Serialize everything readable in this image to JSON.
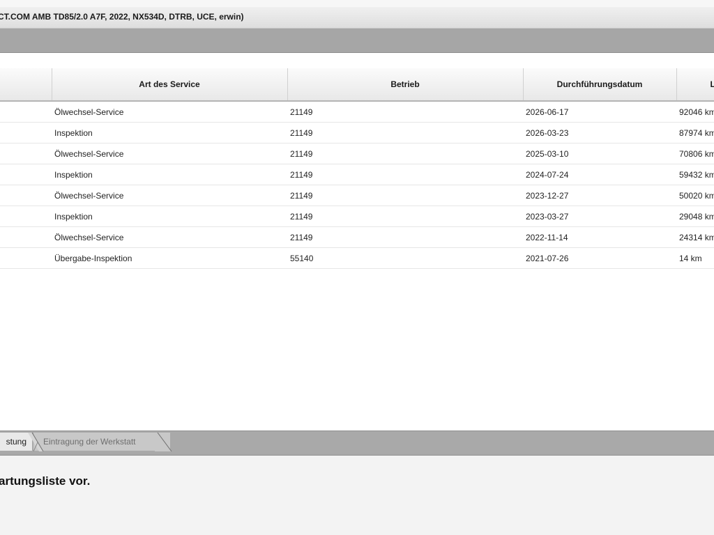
{
  "window": {
    "title": "CT.COM AMB TD85/2.0 A7F, 2022, NX534D, DTRB, UCE, erwin)"
  },
  "table": {
    "headers": [
      "",
      "Art des Service",
      "Betrieb",
      "Durchführungsdatum",
      "L"
    ],
    "rows": [
      {
        "service": "Ölwechsel-Service",
        "betrieb": "21149",
        "date": "2026-06-17",
        "km": "92046 km"
      },
      {
        "service": "Inspektion",
        "betrieb": "21149",
        "date": "2026-03-23",
        "km": "87974 km"
      },
      {
        "service": "Ölwechsel-Service",
        "betrieb": "21149",
        "date": "2025-03-10",
        "km": "70806 km"
      },
      {
        "service": "Inspektion",
        "betrieb": "21149",
        "date": "2024-07-24",
        "km": "59432 km"
      },
      {
        "service": "Ölwechsel-Service",
        "betrieb": "21149",
        "date": "2023-12-27",
        "km": "50020 km"
      },
      {
        "service": "Inspektion",
        "betrieb": "21149",
        "date": "2023-03-27",
        "km": "29048 km"
      },
      {
        "service": "Ölwechsel-Service",
        "betrieb": "21149",
        "date": "2022-11-14",
        "km": "24314 km"
      },
      {
        "service": "Übergabe-Inspektion",
        "betrieb": "55140",
        "date": "2021-07-26",
        "km": "14 km"
      }
    ]
  },
  "tabs": [
    {
      "label": "stung",
      "active": true
    },
    {
      "label": "Eintragung der Werkstatt",
      "active": false
    }
  ],
  "message": "artungsliste vor."
}
